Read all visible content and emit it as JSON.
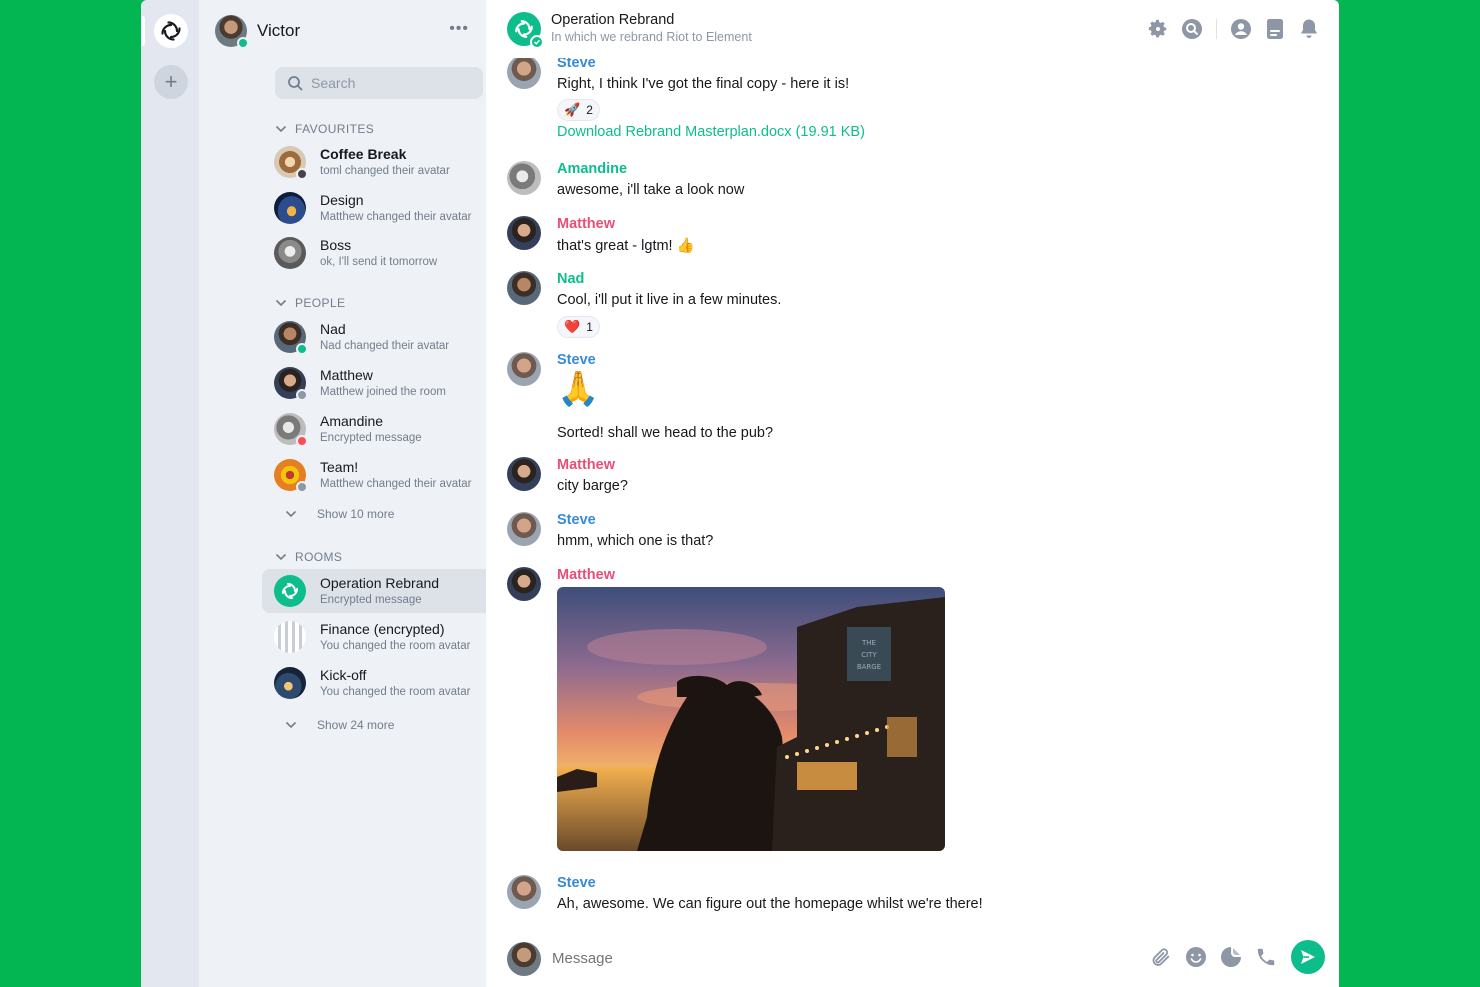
{
  "app": {
    "name": "Element"
  },
  "colors": {
    "accent": "#0dbd8b",
    "background": "#03b651",
    "steve": "#368bd6",
    "amandine": "#0dbd8b",
    "matthew": "#e64f7a",
    "nad": "#0dbd8b"
  },
  "user": {
    "name": "Victor",
    "status": "online"
  },
  "search": {
    "placeholder": "Search"
  },
  "sections": {
    "favourites": {
      "title": "FAVOURITES"
    },
    "people": {
      "title": "PEOPLE",
      "show_more": "Show 10 more"
    },
    "rooms": {
      "title": "ROOMS",
      "show_more": "Show 24 more"
    }
  },
  "favourites": [
    {
      "name": "Coffee Break",
      "preview": "toml changed their avatar",
      "unread": true
    },
    {
      "name": "Design",
      "preview": "Matthew changed their avatar"
    },
    {
      "name": "Boss",
      "preview": "ok, I'll send it tomorrow"
    }
  ],
  "people": [
    {
      "name": "Nad",
      "preview": "Nad changed their avatar",
      "presence": "online"
    },
    {
      "name": "Matthew",
      "preview": "Matthew joined the room",
      "presence": "offline"
    },
    {
      "name": "Amandine",
      "preview": "Encrypted message",
      "presence": "busy"
    },
    {
      "name": "Team!",
      "preview": "Matthew changed their avatar",
      "presence": "offline"
    }
  ],
  "rooms": [
    {
      "name": "Operation Rebrand",
      "preview": "Encrypted message",
      "selected": true
    },
    {
      "name": "Finance (encrypted)",
      "preview": "You changed the room avatar"
    },
    {
      "name": "Kick-off",
      "preview": "You changed the room avatar"
    }
  ],
  "room": {
    "name": "Operation Rebrand",
    "topic": "In which we rebrand Riot to Element",
    "header_icons": [
      "settings-icon",
      "search-icon",
      "people-icon",
      "files-icon",
      "notifications-icon"
    ]
  },
  "messages": [
    {
      "sender": "Steve",
      "body": "Right, I think I've got the final copy - here it is!",
      "reaction": {
        "emoji": "🚀",
        "count": "2"
      },
      "file": "Download Rebrand Masterplan.docx (19.91 KB)"
    },
    {
      "sender": "Amandine",
      "body": "awesome, i'll take a look now"
    },
    {
      "sender": "Matthew",
      "body": "that's great - lgtm! 👍"
    },
    {
      "sender": "Nad",
      "body": "Cool, i'll put it live in a few minutes.",
      "reaction": {
        "emoji": "❤️",
        "count": "1"
      }
    },
    {
      "sender": "Steve",
      "emoji": "🙏",
      "body": "Sorted! shall we head to the pub?"
    },
    {
      "sender": "Matthew",
      "body": "city barge?"
    },
    {
      "sender": "Steve",
      "body": "hmm, which one is that?"
    },
    {
      "sender": "Matthew",
      "image": "photo of pub at sunset by river",
      "image_sign": [
        "THE",
        "CITY",
        "BARGE"
      ]
    },
    {
      "sender": "Steve",
      "body": "Ah, awesome. We can figure out the homepage whilst we're there!"
    }
  ],
  "composer": {
    "placeholder": "Message",
    "icons": [
      "attachment-icon",
      "emoji-icon",
      "sticker-icon",
      "call-icon",
      "send-icon"
    ]
  }
}
